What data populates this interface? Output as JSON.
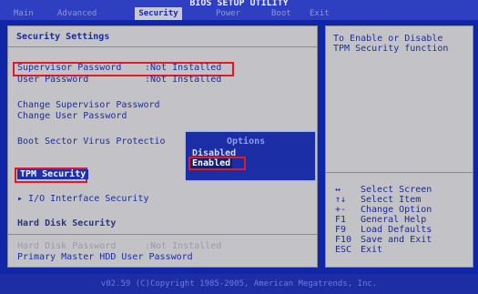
{
  "title": "BIOS SETUP UTILITY",
  "tabs": [
    "Main",
    "Advanced",
    "Security",
    "Power",
    "Boot",
    "Exit"
  ],
  "active_tab": "Security",
  "left": {
    "section_title": "Security Settings",
    "supervisor_password": {
      "label": "Supervisor Password",
      "value": ":Not Installed"
    },
    "user_password": {
      "label": "User Password",
      "value": ":Not Installed"
    },
    "change_supervisor": "Change Supervisor Password",
    "change_user": "Change User Password",
    "boot_sector": "Boot Sector Virus Protectio",
    "tpm_security": "TPM Security",
    "io_interface_security": "▸ I/O Interface Security",
    "hard_disk_security": "Hard Disk Security",
    "hard_disk_password": {
      "label": "Hard Disk Password",
      "value": ":Not Installed"
    },
    "primary_master": "Primary Master HDD User Password"
  },
  "popup": {
    "title": "Options",
    "options": [
      "Disabled",
      "Enabled"
    ],
    "selected": "Enabled"
  },
  "right": {
    "help_line1": "To Enable or Disable",
    "help_line2": "TPM Security function",
    "keys": [
      {
        "key": "↔",
        "desc": "Select Screen"
      },
      {
        "key": "↑↓",
        "desc": "Select Item"
      },
      {
        "key": "+-",
        "desc": "Change Option"
      },
      {
        "key": "F1",
        "desc": "General Help"
      },
      {
        "key": "F9",
        "desc": "Load Defaults"
      },
      {
        "key": "F10",
        "desc": "Save and Exit"
      },
      {
        "key": "ESC",
        "desc": "Exit"
      }
    ]
  },
  "footer": "v02.59 (C)Copyright 1985-2005, American Megatrends, Inc.",
  "colors": {
    "accent": "#e01a2a",
    "bios_blue": "#0f27a6",
    "panel": "#c2c2c7"
  }
}
